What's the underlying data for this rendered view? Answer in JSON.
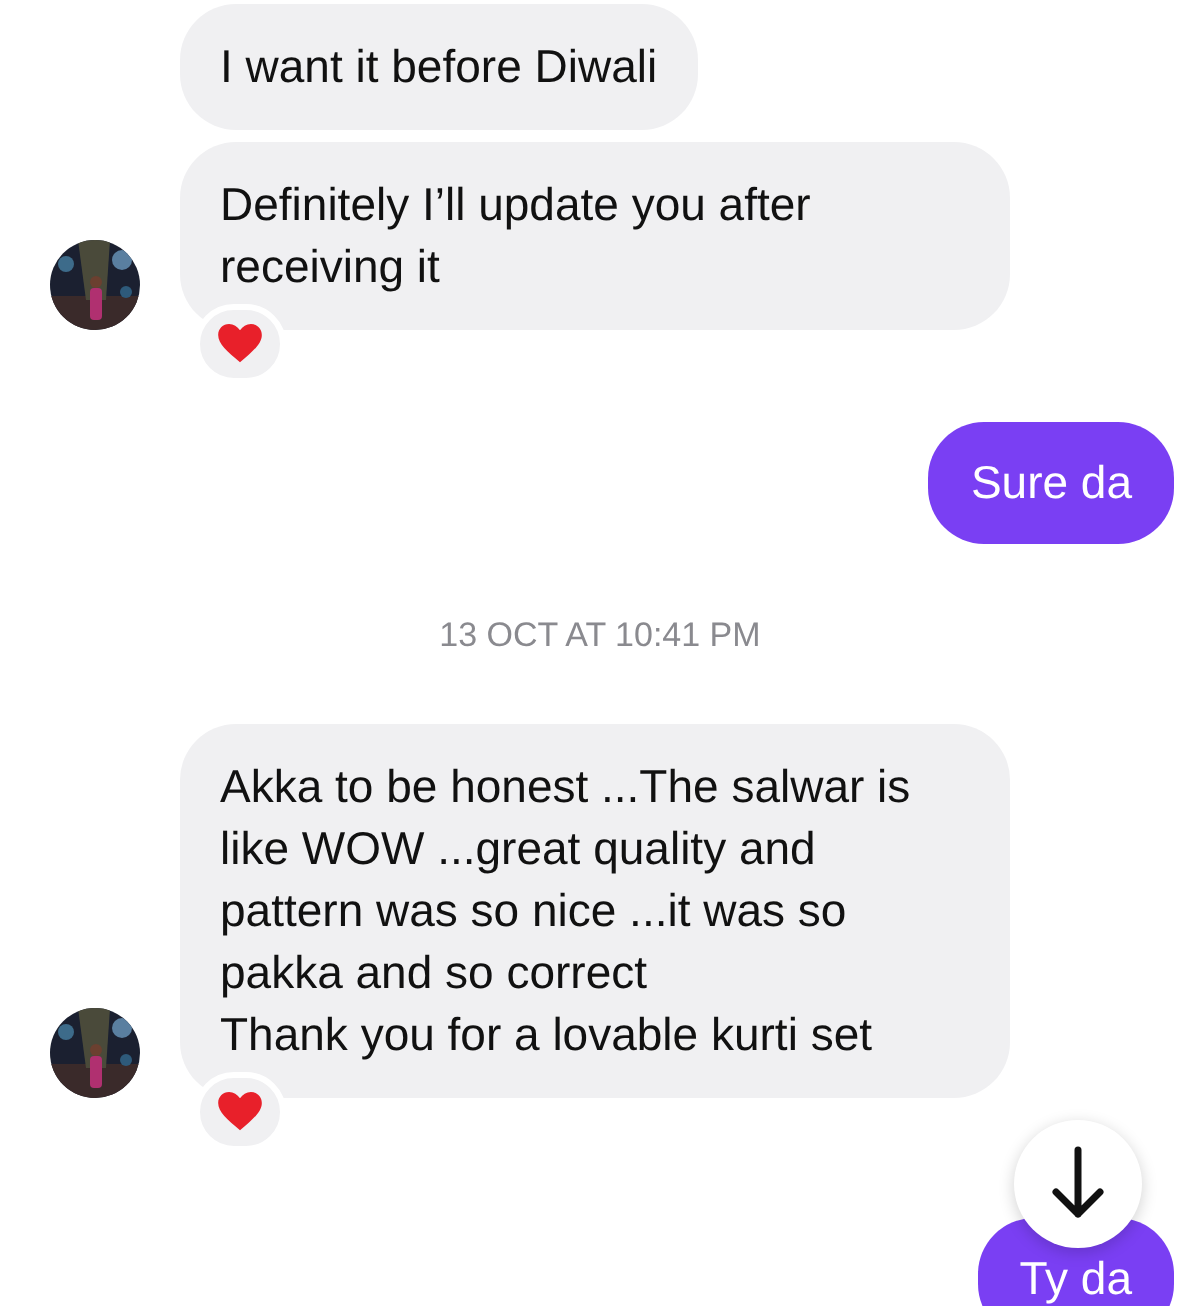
{
  "messages": [
    {
      "kind": "received",
      "text": "I want it before Diwali",
      "avatar": false,
      "reaction": false
    },
    {
      "kind": "received",
      "text": "Definitely I’ll update you after receiving it",
      "avatar": true,
      "reaction": true
    },
    {
      "kind": "sent",
      "text": "Sure da"
    },
    {
      "kind": "timestamp",
      "text": "13 OCT AT 10:41 PM"
    },
    {
      "kind": "received",
      "text": "Akka to be honest ...The salwar is like WOW ...great quality and pattern was so nice ...it was so pakka and so correct\nThank you for a lovable kurti set",
      "avatar": true,
      "reaction": true
    },
    {
      "kind": "sent",
      "text": "Ty da"
    }
  ],
  "scroll_down_button": true
}
